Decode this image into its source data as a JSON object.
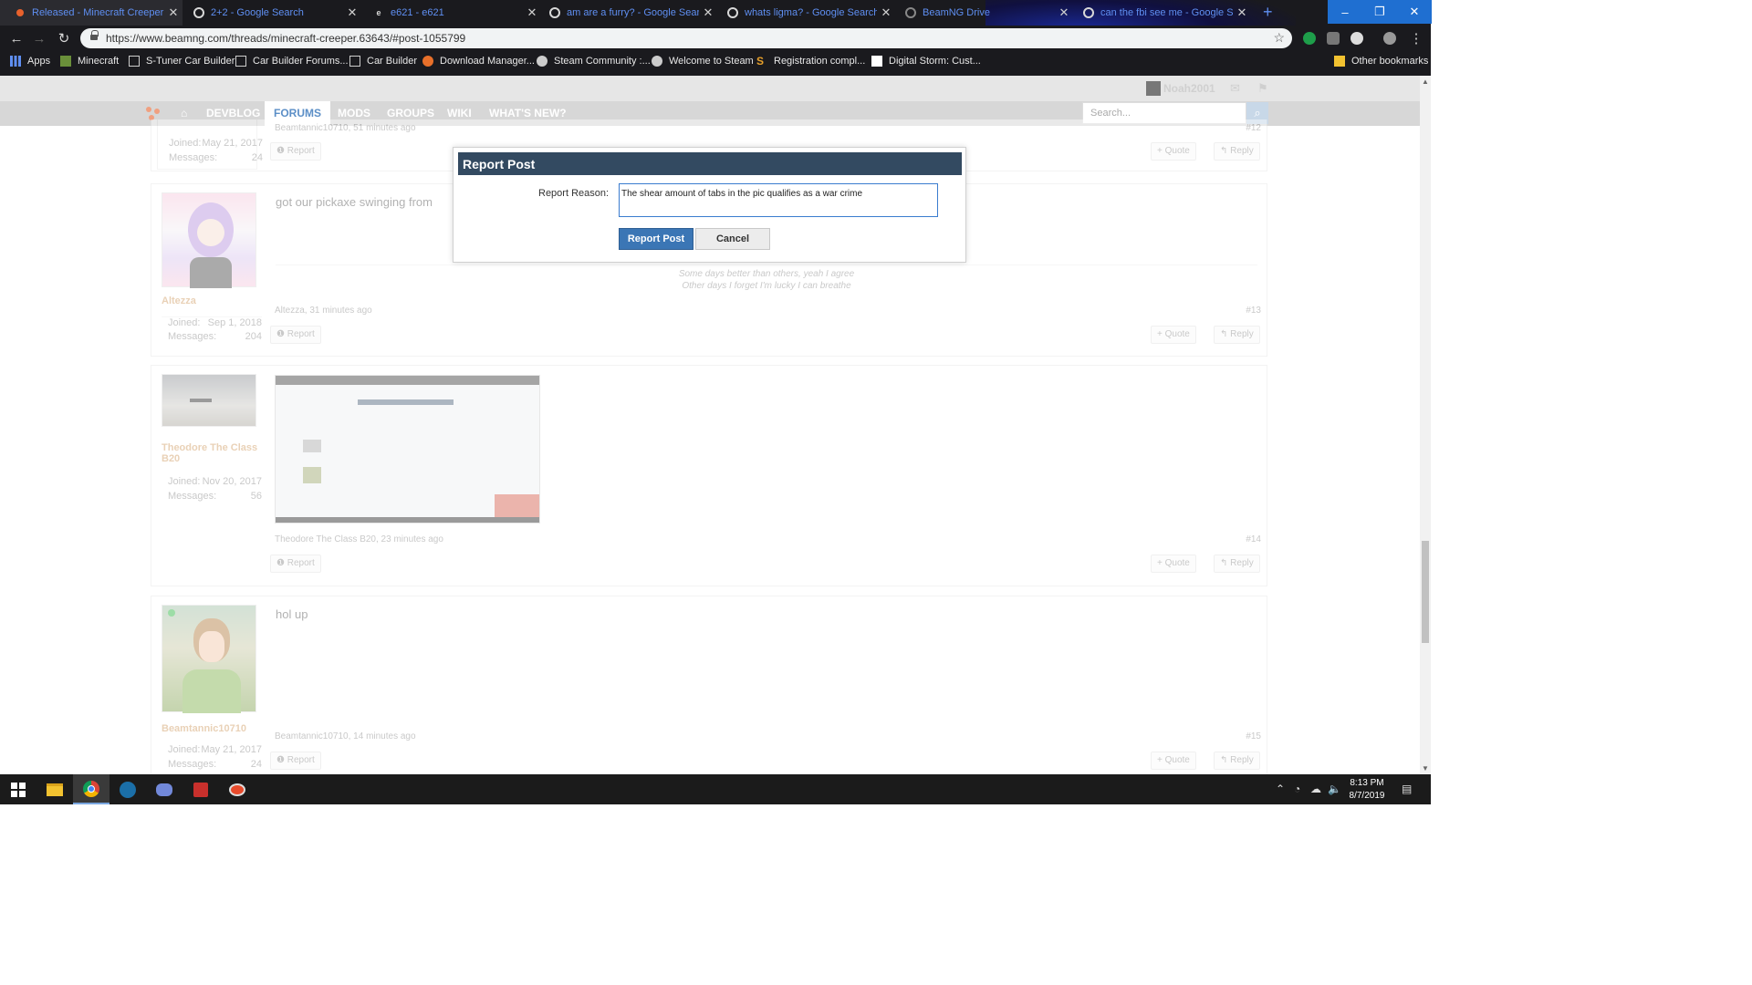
{
  "tabs": [
    {
      "label": "Released - Minecraft Creeper | BeamNG",
      "icon": "beamng-icon"
    },
    {
      "label": "2+2 - Google Search",
      "icon": "google-icon"
    },
    {
      "label": "e621 - e621",
      "icon": "e621-icon"
    },
    {
      "label": "am are a furry? - Google Search",
      "icon": "google-icon"
    },
    {
      "label": "whats ligma? - Google Search",
      "icon": "google-icon"
    },
    {
      "label": "BeamNG Drive",
      "icon": "beamng-drive-icon"
    },
    {
      "label": "can the fbi see me - Google Search",
      "icon": "google-icon"
    }
  ],
  "window_controls": {
    "minimize": "–",
    "restore": "❐",
    "close": "✕",
    "new_tab": "+"
  },
  "address_bar": {
    "url": "https://www.beamng.com/threads/minecraft-creeper.63643/#post-1055799"
  },
  "bookmarks": [
    {
      "label": "Apps",
      "icon": "apps-grid-icon"
    },
    {
      "label": "Minecraft",
      "icon": "minecraft-icon"
    },
    {
      "label": "S-Tuner Car Builder",
      "icon": "grid-icon"
    },
    {
      "label": "Car Builder Forums...",
      "icon": "grid-icon"
    },
    {
      "label": "Car Builder",
      "icon": "grid-icon"
    },
    {
      "label": "Download Manager...",
      "icon": "download-icon"
    },
    {
      "label": "Steam Community :...",
      "icon": "steam-icon"
    },
    {
      "label": "Welcome to Steam",
      "icon": "steam-icon"
    },
    {
      "label": "Registration compl...",
      "icon": "s-icon"
    },
    {
      "label": "Digital Storm: Cust...",
      "icon": "digital-storm-icon"
    },
    {
      "label": "Other bookmarks",
      "icon": "folder-icon"
    }
  ],
  "user": {
    "name": "Noah2001"
  },
  "nav": {
    "items": [
      "DEVBLOG",
      "FORUMS",
      "MODS",
      "GROUPS",
      "WIKI",
      "WHAT'S NEW?"
    ],
    "active": "FORUMS",
    "search_placeholder": "Search..."
  },
  "posts": [
    {
      "author_meta": "Beamtannic10710, 51 minutes ago",
      "number": "#12",
      "joined_label": "Joined:",
      "joined": "May 21, 2017",
      "messages_label": "Messages:",
      "messages": "24"
    },
    {
      "author": "Altezza",
      "text": "got our pickaxe swinging from",
      "signature": [
        "Some days better than others, yeah I agree",
        "Other days I forget I'm lucky I can breathe"
      ],
      "author_meta": "Altezza, 31 minutes ago",
      "number": "#13",
      "joined_label": "Joined:",
      "joined": "Sep 1, 2018",
      "messages_label": "Messages:",
      "messages": "204"
    },
    {
      "author": "Theodore The Class B20",
      "author_meta": "Theodore The Class B20, 23 minutes ago",
      "number": "#14",
      "joined_label": "Joined:",
      "joined": "Nov 20, 2017",
      "messages_label": "Messages:",
      "messages": "56"
    },
    {
      "author": "Beamtannic10710",
      "text": "hol up",
      "author_meta": "Beamtannic10710, 14 minutes ago",
      "number": "#15",
      "joined_label": "Joined:",
      "joined": "May 21, 2017",
      "messages_label": "Messages:",
      "messages": "24"
    }
  ],
  "post_actions": {
    "report": "Report",
    "quote": "+ Quote",
    "reply": "Reply"
  },
  "modal": {
    "title": "Report Post",
    "reason_label": "Report Reason:",
    "reason_value": "The shear amount of tabs in the pic qualifies as a war crime",
    "submit": "Report Post",
    "cancel": "Cancel"
  },
  "taskbar": {
    "apps": [
      "windows-start-icon",
      "file-explorer-icon",
      "chrome-icon",
      "steam-icon",
      "discord-icon",
      "red-app-icon",
      "beamng-taskbar-icon"
    ],
    "time": "8:13 PM",
    "date": "8/7/2019"
  },
  "colors": {
    "accent": "#5c8fc7",
    "modal_header": "#334a61",
    "primary_button": "#3b76b5",
    "tab_text": "#5f8ff2"
  }
}
